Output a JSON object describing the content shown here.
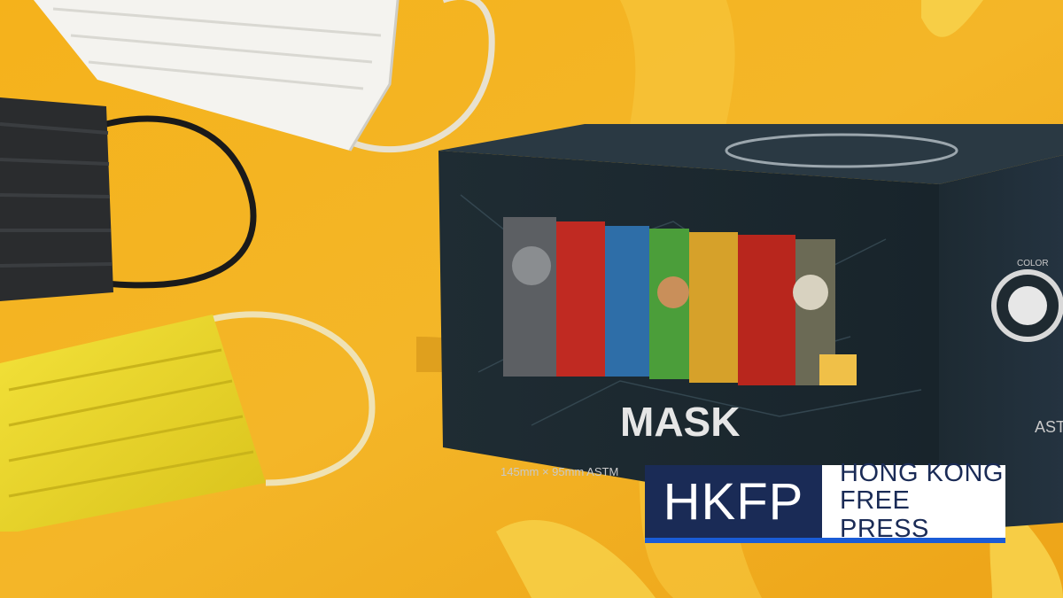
{
  "scene": {
    "background_color": "#f2b320",
    "description_icons": [
      "white-mask",
      "black-mask",
      "yellow-mask",
      "mask-box"
    ]
  },
  "box": {
    "product_label": "MASK",
    "size_label": "145mm × 95mm ASTM",
    "side_label": "AST",
    "side_badge_label": "COLOR"
  },
  "logo": {
    "mark": "HKFP",
    "line1": "HONG KONG",
    "line2": "FREE PRESS",
    "brand_color": "#1a2b56",
    "accent_color": "#1a5cd6"
  }
}
